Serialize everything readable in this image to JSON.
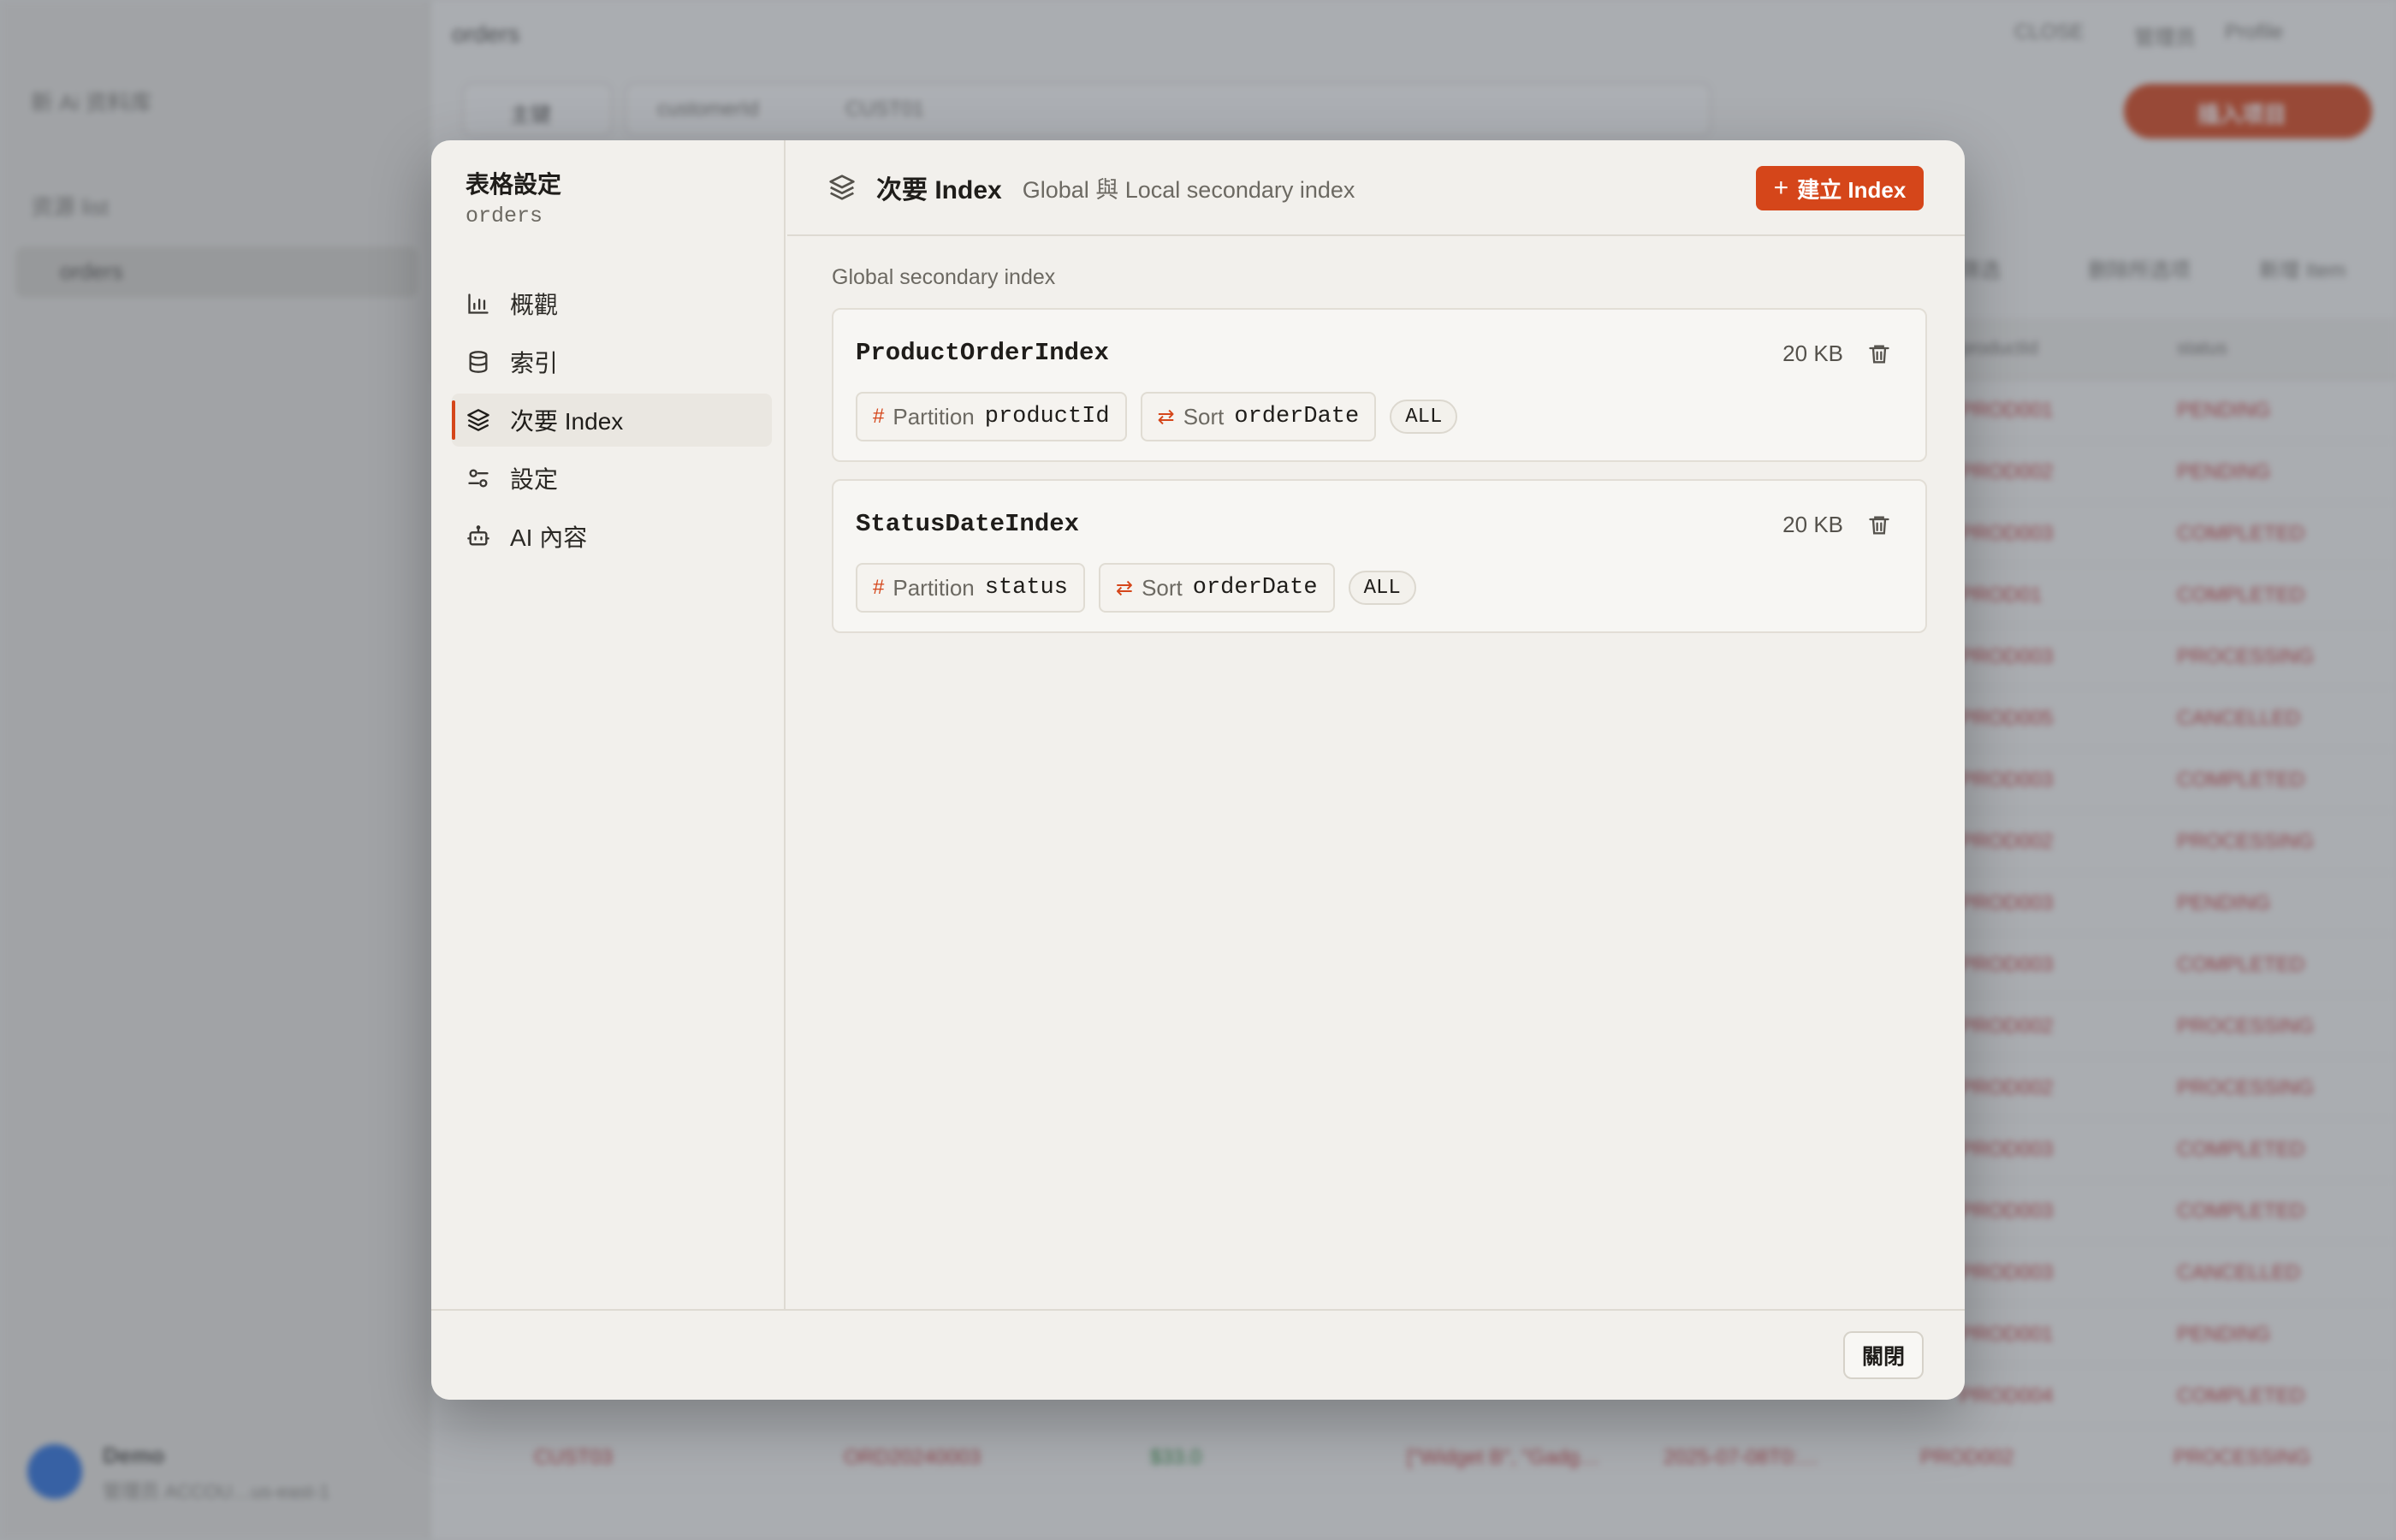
{
  "background": {
    "sidebar": {
      "items": [
        "新 Ai 资料库",
        "资源 list"
      ],
      "active_item": "orders",
      "user_name": "Demo",
      "user_sub": "管理员 ACCOU…us-east-1"
    },
    "topbar_title": "orders",
    "top_right": [
      "CLOSE",
      "管理员",
      "Profile"
    ],
    "filter_label": "主键",
    "filter_field": "customerId",
    "filter_value": "CUST01",
    "primary_button": "插入项目",
    "table_actions": [
      "筛选",
      "删除所选项",
      "新增 Item"
    ],
    "columns": [
      "productId",
      "status"
    ],
    "rows": [
      [
        "PROD001",
        "PENDING"
      ],
      [
        "PROD002",
        "PENDING"
      ],
      [
        "PROD003",
        "COMPLETED"
      ],
      [
        "PROD01",
        "COMPLETED"
      ],
      [
        "PROD003",
        "PROCESSING"
      ],
      [
        "PROD005",
        "CANCELLED"
      ],
      [
        "PROD003",
        "COMPLETED"
      ],
      [
        "PROD002",
        "PROCESSING"
      ],
      [
        "PROD003",
        "PENDING"
      ],
      [
        "PROD003",
        "COMPLETED"
      ],
      [
        "PROD002",
        "PROCESSING"
      ],
      [
        "PROD002",
        "PROCESSING"
      ],
      [
        "PROD003",
        "COMPLETED"
      ],
      [
        "PROD003",
        "COMPLETED"
      ],
      [
        "PROD003",
        "CANCELLED"
      ],
      [
        "PROD001",
        "PENDING"
      ],
      [
        "PROD004",
        "COMPLETED"
      ]
    ],
    "bottom_row": [
      "CUST03",
      "ORD20240003",
      "$33.0",
      "[\"Widget B\", \"Gadg…",
      "2025-07-08T0:…",
      "PROD002",
      "PROCESSING"
    ]
  },
  "modal": {
    "title": "表格設定",
    "table_name": "orders",
    "nav": [
      {
        "label": "概觀",
        "icon": "bar-chart-icon"
      },
      {
        "label": "索引",
        "icon": "database-icon"
      },
      {
        "label": "次要 Index",
        "icon": "layers-icon"
      },
      {
        "label": "設定",
        "icon": "sliders-icon"
      },
      {
        "label": "AI 內容",
        "icon": "robot-icon"
      }
    ],
    "header": {
      "title": "次要 Index",
      "subtitle": "Global 與 Local secondary index",
      "create_button": "建立 Index"
    },
    "section_label": "Global secondary index",
    "indexes": [
      {
        "name": "ProductOrderIndex",
        "size": "20 KB",
        "partition_label": "Partition",
        "partition_key": "productId",
        "sort_label": "Sort",
        "sort_key": "orderDate",
        "projection": "ALL"
      },
      {
        "name": "StatusDateIndex",
        "size": "20 KB",
        "partition_label": "Partition",
        "partition_key": "status",
        "sort_label": "Sort",
        "sort_key": "orderDate",
        "projection": "ALL"
      }
    ],
    "close_button": "關閉"
  },
  "colors": {
    "accent": "#d5461a",
    "scrim": "#464e5f"
  }
}
